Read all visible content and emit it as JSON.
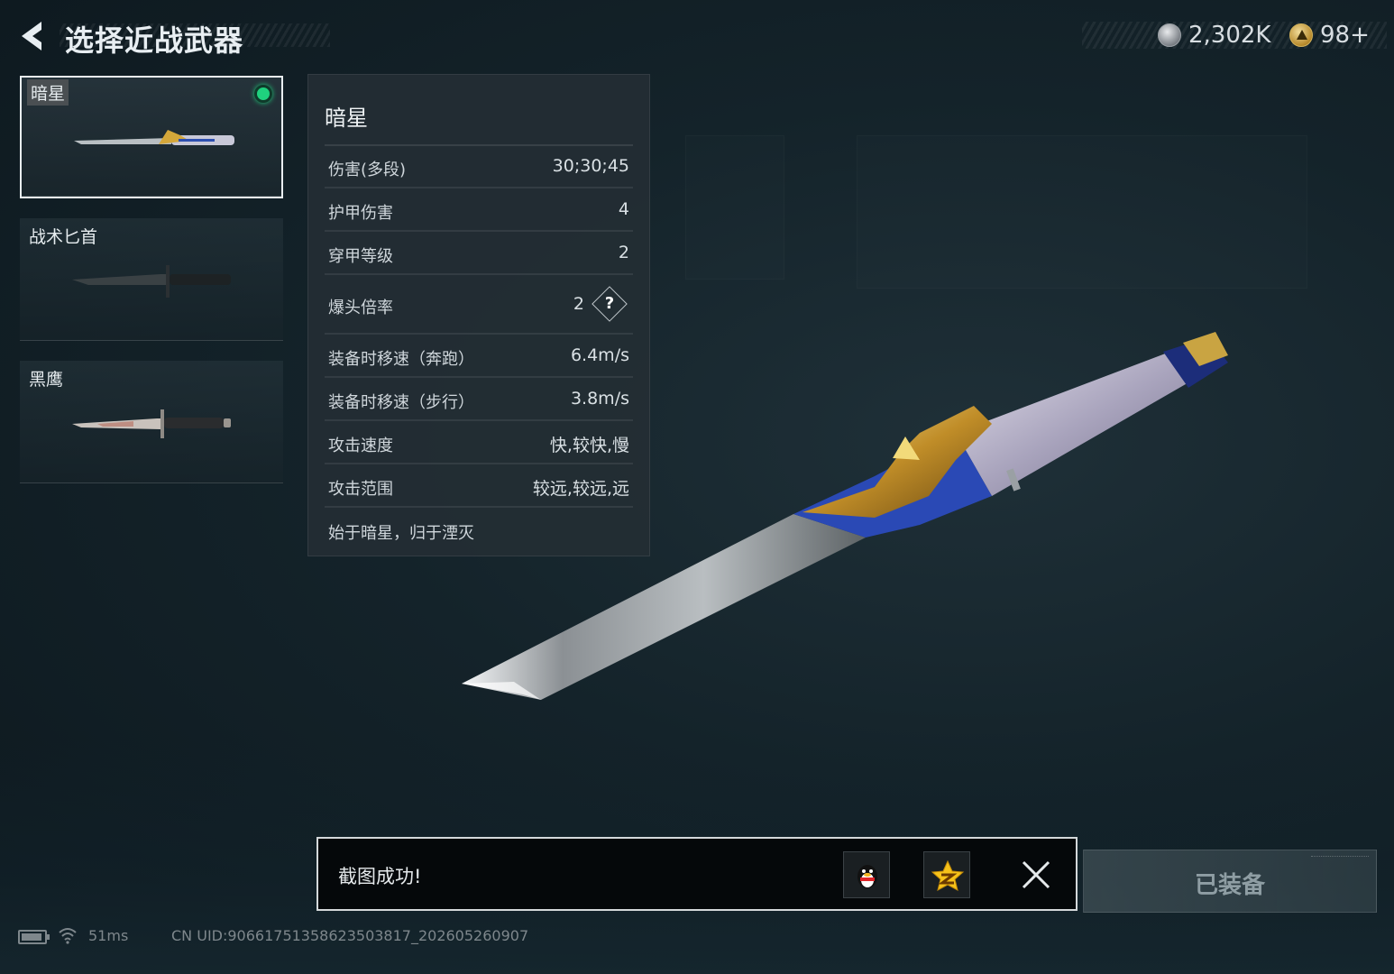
{
  "header": {
    "title": "选择近战武器",
    "currency_silver": "2,302K",
    "currency_gold": "98+"
  },
  "weapons": [
    {
      "name": "暗星",
      "selected": true,
      "equipped": true
    },
    {
      "name": "战术匕首",
      "selected": false
    },
    {
      "name": "黑鹰",
      "selected": false
    }
  ],
  "stats": {
    "title": "暗星",
    "rows": [
      {
        "label": "伤害(多段)",
        "value": "30;30;45"
      },
      {
        "label": "护甲伤害",
        "value": "4"
      },
      {
        "label": "穿甲等级",
        "value": "2"
      },
      {
        "label": "爆头倍率",
        "value": "2"
      },
      {
        "label": "装备时移速（奔跑）",
        "value": "6.4m/s"
      },
      {
        "label": "装备时移速（步行）",
        "value": "3.8m/s"
      },
      {
        "label": "攻击速度",
        "value": "快,较快,慢"
      },
      {
        "label": "攻击范围",
        "value": "较远,较远,远"
      }
    ],
    "help_glyph": "?",
    "motto": "始于暗星，归于湮灭"
  },
  "toast": {
    "message": "截图成功!"
  },
  "equip_button": {
    "label": "已装备"
  },
  "footer": {
    "ping": "51ms",
    "uid": "CN UID:9066175135862350381​7_202605260907"
  },
  "colors": {
    "equipped_dot": "#1fd17e",
    "background": "#14232a"
  }
}
